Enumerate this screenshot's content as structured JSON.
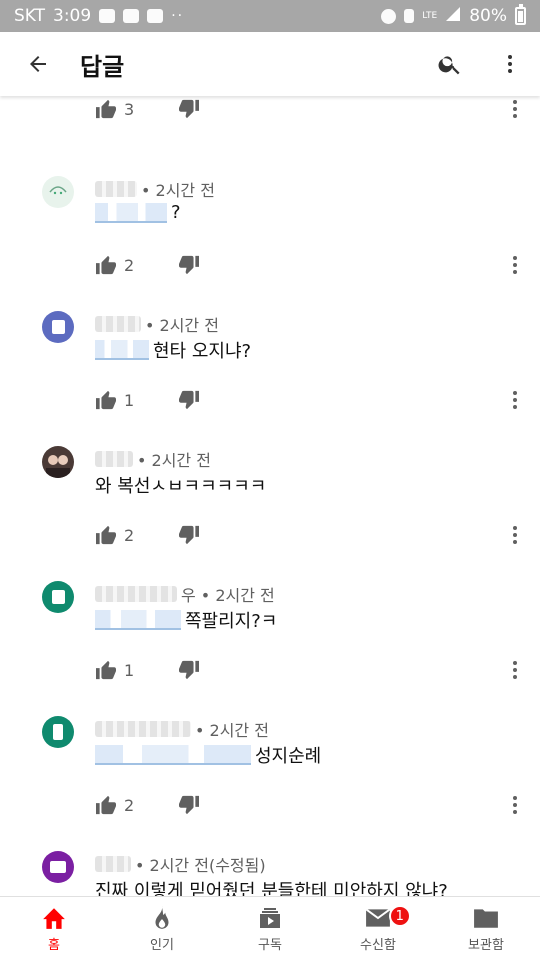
{
  "status_bar": {
    "carrier": "SKT",
    "time": "3:09",
    "dots": "··",
    "network": "LTE",
    "battery": "80%"
  },
  "header": {
    "title": "답글",
    "back_icon": "arrow-left-icon",
    "search_icon": "search-icon",
    "menu_icon": "more-vert-icon"
  },
  "colors": {
    "accent": "#ff0000",
    "mention": "#3e7fc4",
    "meta": "#606060"
  },
  "replies": [
    {
      "avatar_color": "",
      "time": "",
      "text": "",
      "mention": false,
      "likes": "3"
    },
    {
      "avatar_color": "#e8f3ec",
      "time": "• 2시간 전",
      "text": "?",
      "mention": true,
      "likes": "2"
    },
    {
      "avatar_color": "#5c6bc0",
      "time": "• 2시간 전",
      "text": "현타 오지냐?",
      "mention": true,
      "likes": "1"
    },
    {
      "avatar_color": "#4a3a36",
      "time": "• 2시간 전",
      "text": "와 복선ㅅㅂㅋㅋㅋㅋㅋ",
      "mention": false,
      "likes": "2"
    },
    {
      "avatar_color": "#0f8a6e",
      "time": "우 • 2시간 전",
      "text": "쪽팔리지?ㅋ",
      "mention": true,
      "likes": "1"
    },
    {
      "avatar_color": "#0f8a6e",
      "time": "• 2시간 전",
      "text": "성지순례",
      "mention": true,
      "likes": "2"
    },
    {
      "avatar_color": "#7b1fa2",
      "time": "• 2시간 전(수정됨)",
      "text": "진짜 이렇게 믿어줬던 분들한테 미안하지 않냐?",
      "mention": false,
      "likes": ""
    }
  ],
  "bottom_nav": [
    {
      "label": "홈",
      "icon": "home-icon",
      "active": true
    },
    {
      "label": "인기",
      "icon": "flame-icon",
      "active": false
    },
    {
      "label": "구독",
      "icon": "subscriptions-icon",
      "active": false
    },
    {
      "label": "수신함",
      "icon": "mail-icon",
      "active": false,
      "badge": "1"
    },
    {
      "label": "보관함",
      "icon": "folder-icon",
      "active": false
    }
  ]
}
